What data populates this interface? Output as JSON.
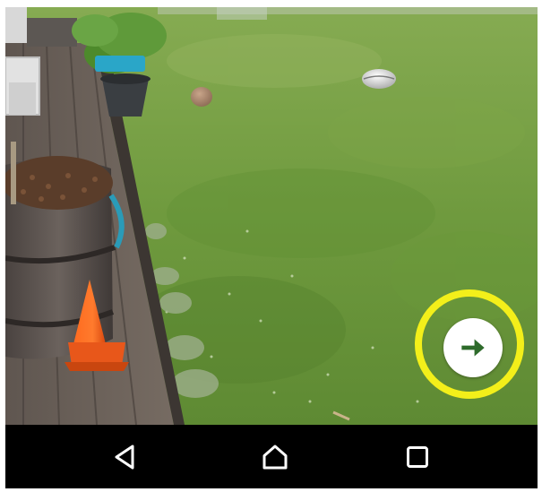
{
  "screen": {
    "content": "camera-viewfinder"
  },
  "overlay": {
    "next_button_icon": "arrow-right-icon",
    "ring_color": "#f3ef1a",
    "button_color": "#ffffff",
    "arrow_color": "#2e6b2b"
  },
  "nav_bar": {
    "background": "#000000",
    "buttons": [
      {
        "icon": "back-triangle-icon"
      },
      {
        "icon": "home-icon"
      },
      {
        "icon": "recents-square-icon"
      }
    ]
  }
}
